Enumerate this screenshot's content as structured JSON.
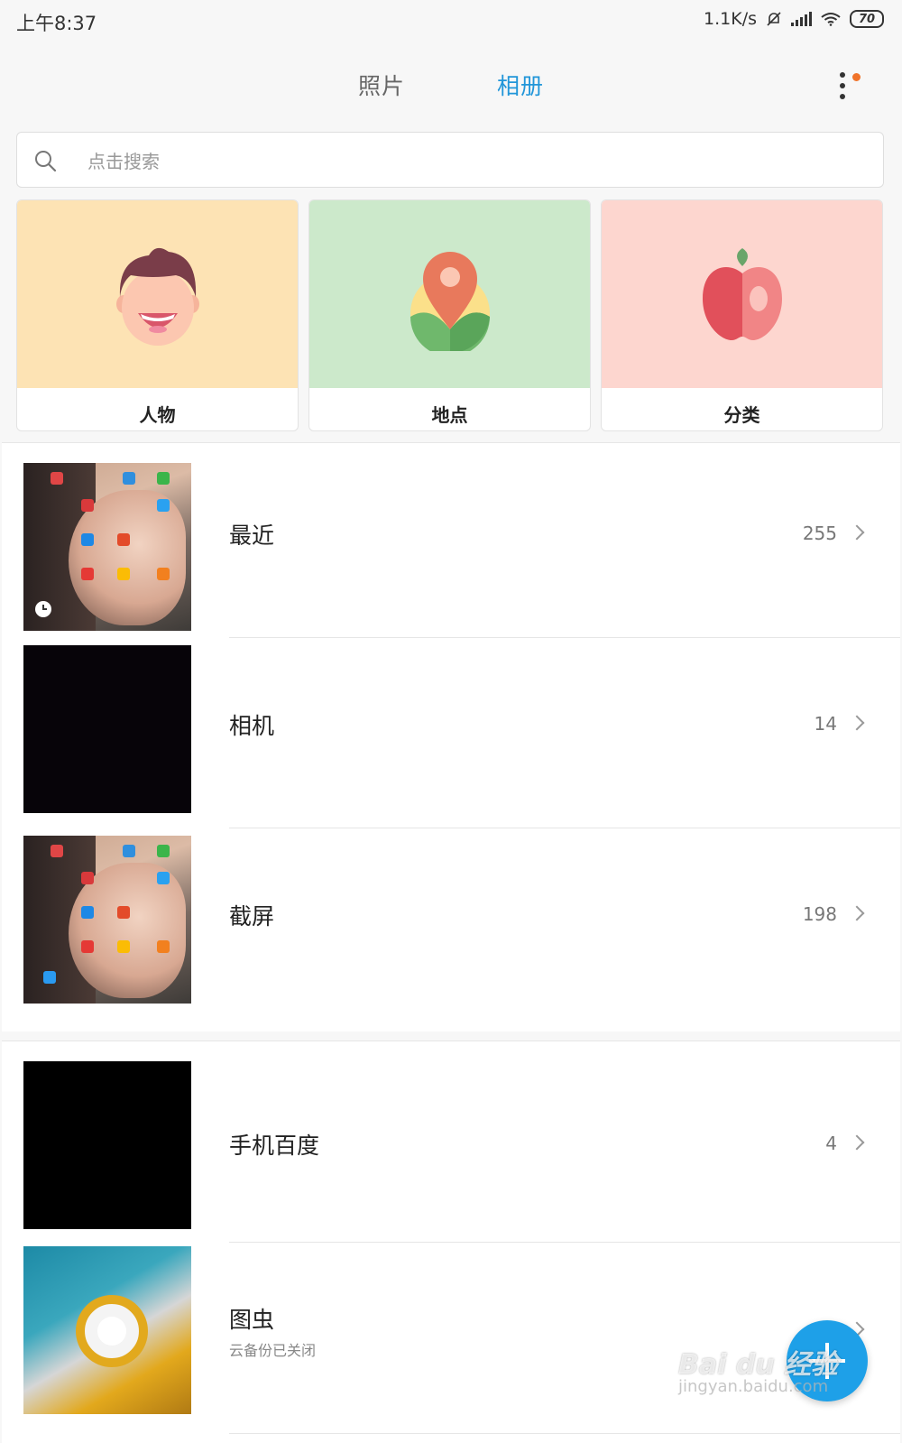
{
  "status_bar": {
    "time": "上午8:37",
    "network_speed": "1.1K/s",
    "battery": "70"
  },
  "tabs": [
    {
      "label": "照片",
      "active": false
    },
    {
      "label": "相册",
      "active": true
    }
  ],
  "search": {
    "placeholder": "点击搜索"
  },
  "categories": [
    {
      "label": "人物",
      "icon": "face-icon"
    },
    {
      "label": "地点",
      "icon": "location-pin-icon"
    },
    {
      "label": "分类",
      "icon": "apple-icon"
    }
  ],
  "albums": [
    {
      "name": "最近",
      "count": "255"
    },
    {
      "name": "相机",
      "count": "14"
    },
    {
      "name": "截屏",
      "count": "198"
    },
    {
      "name": "手机百度",
      "count": "4"
    },
    {
      "name": "图虫",
      "subtitle": "云备份已关闭"
    }
  ],
  "colors": {
    "accent": "#2196d9",
    "fab": "#1ea0e8",
    "notification_dot": "#f0732a"
  },
  "watermark": {
    "text": "Bai du 经验",
    "url": "jingyan.baidu.com"
  }
}
